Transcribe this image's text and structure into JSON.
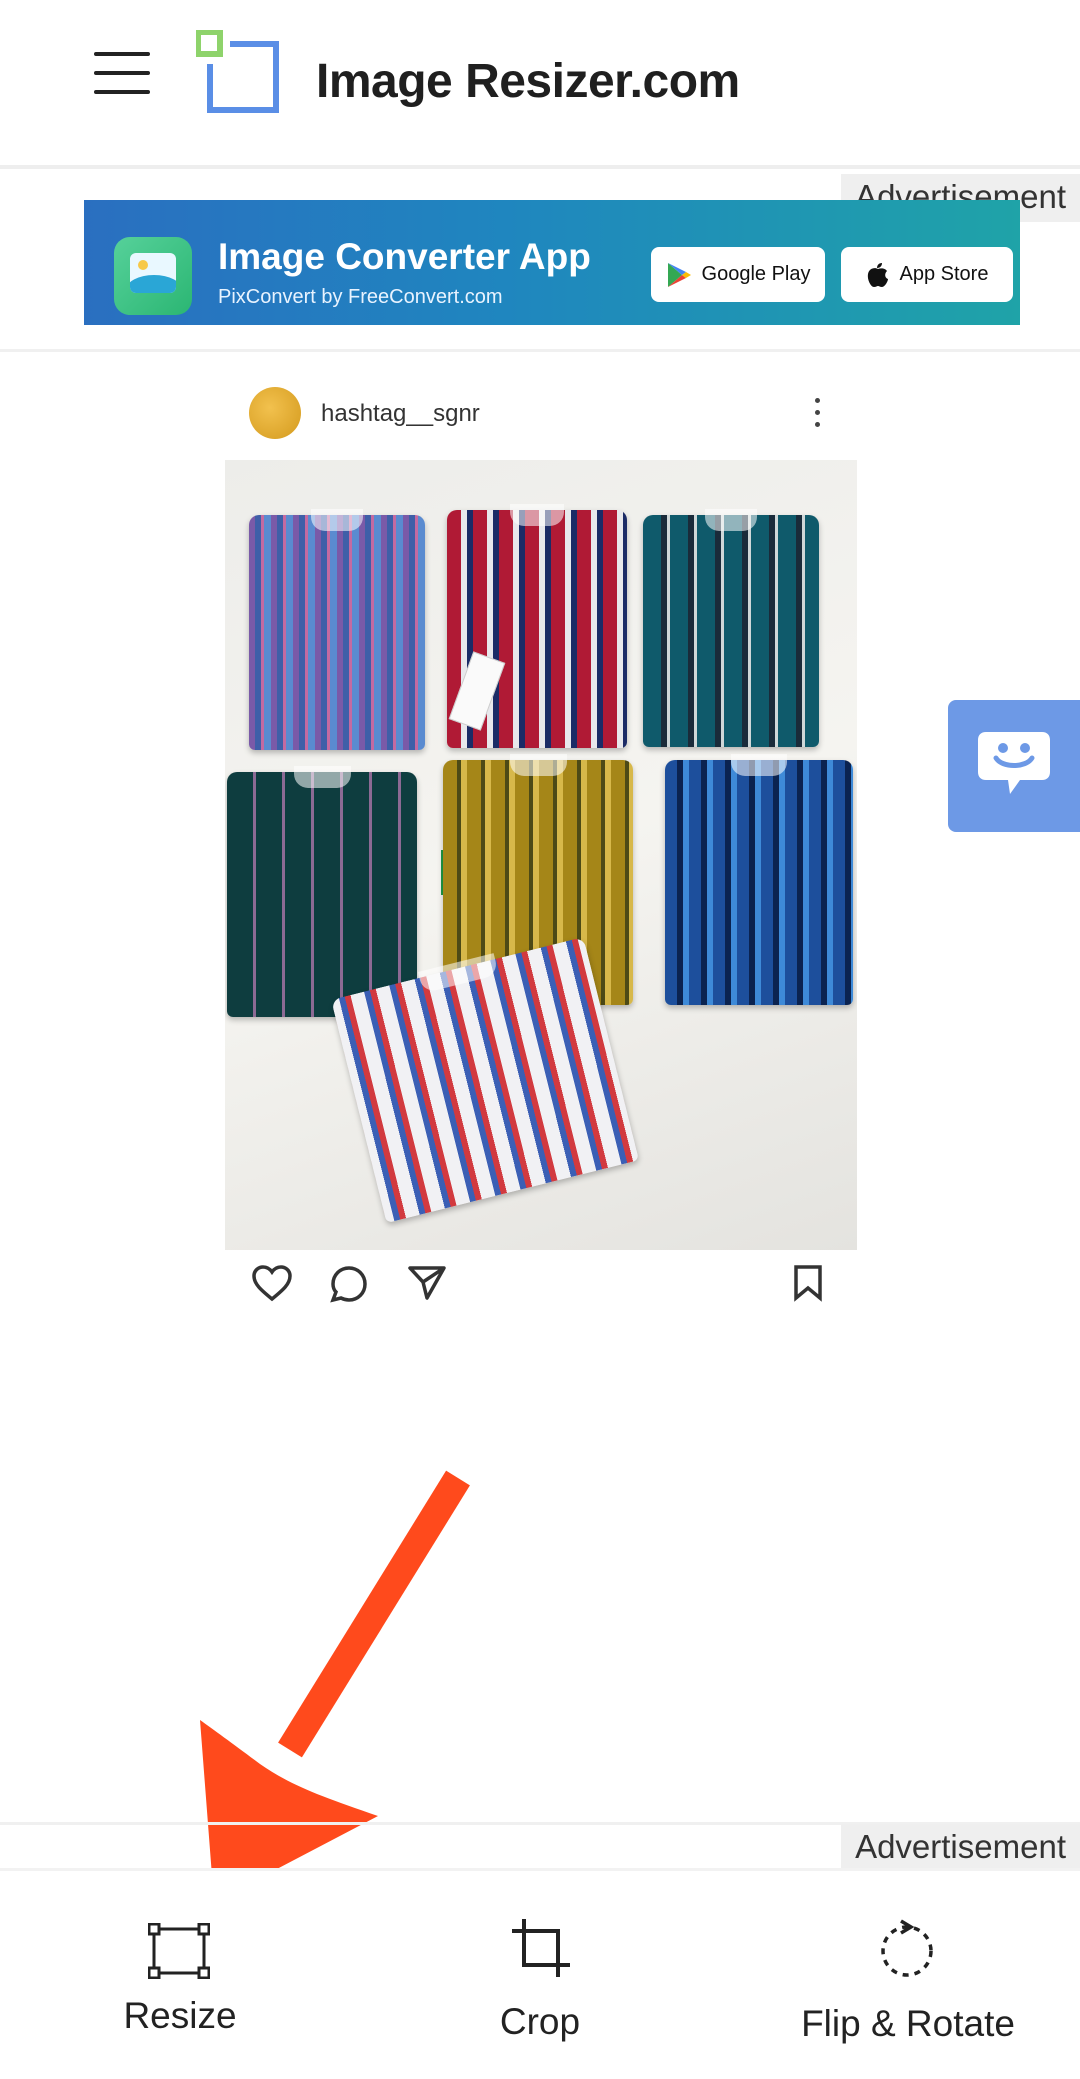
{
  "header": {
    "brand": "Image Resizer.com"
  },
  "ads": {
    "label_top": "Advertisement",
    "label_bottom": "Advertisement",
    "banner": {
      "title": "Image Converter App",
      "subtitle": "PixConvert by FreeConvert.com",
      "google_play": "Google Play",
      "app_store": "App Store"
    }
  },
  "post": {
    "username": "hashtag__sgnr"
  },
  "toolbar": {
    "resize": "Resize",
    "crop": "Crop",
    "flip_rotate": "Flip & Rotate"
  },
  "colors": {
    "accent_chat": "#6d99e6",
    "arrow": "#ff4a1c",
    "logo_green": "#8ed36b",
    "logo_blue": "#5a8ee6"
  }
}
